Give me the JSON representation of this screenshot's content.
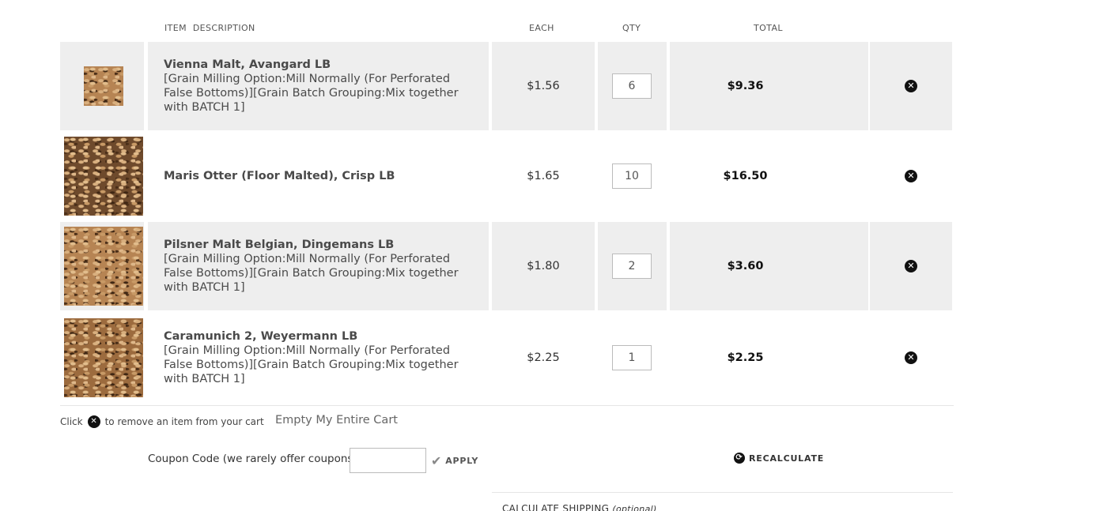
{
  "headers": {
    "item": "ITEM",
    "description": "DESCRIPTION",
    "each": "EACH",
    "qty": "QTY",
    "total": "TOTAL"
  },
  "items": [
    {
      "name": "Vienna Malt, Avangard LB",
      "options": "[Grain Milling Option:Mill Normally (For Perforated False Bottoms)][Grain Batch Grouping:Mix together with BATCH 1]",
      "each": "$1.56",
      "qty": "6",
      "total": "$9.36",
      "thumb_icon": "grain-photo"
    },
    {
      "name": "Maris Otter (Floor Malted), Crisp LB",
      "options": "",
      "each": "$1.65",
      "qty": "10",
      "total": "$16.50",
      "thumb_icon": "grain-photo"
    },
    {
      "name": "Pilsner Malt Belgian, Dingemans LB",
      "options": "[Grain Milling Option:Mill Normally (For Perforated False Bottoms)][Grain Batch Grouping:Mix together with BATCH 1]",
      "each": "$1.80",
      "qty": "2",
      "total": "$3.60",
      "thumb_icon": "grain-photo"
    },
    {
      "name": "Caramunich 2, Weyermann LB",
      "options": "[Grain Milling Option:Mill Normally (For Perforated False Bottoms)][Grain Batch Grouping:Mix together with BATCH 1]",
      "each": "$2.25",
      "qty": "1",
      "total": "$2.25",
      "thumb_icon": "grain-photo"
    }
  ],
  "remove_icon": "close-circle-icon",
  "hint": {
    "prefix": "Click",
    "suffix": "to remove an item from your cart"
  },
  "empty_cart_label": "Empty My Entire Cart",
  "coupon": {
    "label": "Coupon Code (we rarely offer coupons)",
    "value": "",
    "apply_label": "APPLY"
  },
  "recalculate_label": "RECALCULATE",
  "shipping": {
    "label": "CALCULATE SHIPPING",
    "note": "(optional)"
  },
  "colors": {
    "row_shade": "#eeeeee",
    "remove_button": "#111111"
  }
}
